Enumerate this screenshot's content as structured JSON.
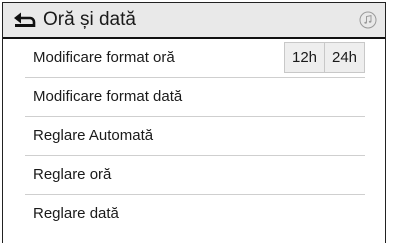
{
  "header": {
    "title": "Oră și dată",
    "back_icon": "back-arrow-icon",
    "music_icon": "music-note-icon"
  },
  "rows": [
    {
      "label": "Modificare format oră",
      "options": [
        "12h",
        "24h"
      ]
    },
    {
      "label": "Modificare format dată"
    },
    {
      "label": "Reglare Automată"
    },
    {
      "label": "Reglare oră"
    },
    {
      "label": "Reglare dată"
    }
  ],
  "colors": {
    "header_bg": "#e9e9e9",
    "text": "#1a1a1a",
    "divider": "#cfcfcf",
    "segment_bg": "#eeeeee"
  }
}
